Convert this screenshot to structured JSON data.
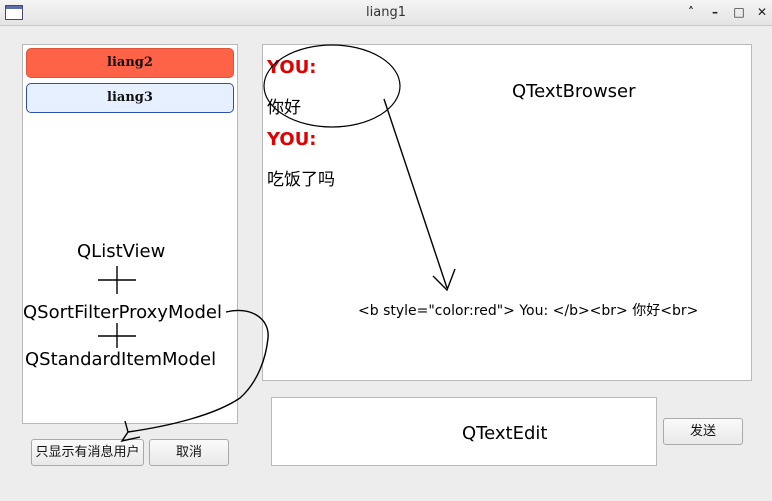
{
  "window": {
    "title": "liang1"
  },
  "user_list": {
    "items": [
      {
        "label": "liang2"
      },
      {
        "label": "liang3"
      }
    ]
  },
  "annotations": {
    "list_view": "QListView",
    "proxy_model": "QSortFilterProxyModel",
    "item_model": "QStandardItemModel",
    "browser": "QTextBrowser",
    "html_sample": "<b style=\"color:red\"> You: </b><br> 你好<br>",
    "edit": "QTextEdit"
  },
  "chat": {
    "messages": [
      {
        "sender": "YOU:",
        "text": "你好"
      },
      {
        "sender": "YOU:",
        "text": "吃饭了吗"
      }
    ]
  },
  "buttons": {
    "show_with_messages": "只显示有消息用户",
    "cancel": "取消",
    "send": "发送"
  },
  "colors": {
    "sender": "#e00000",
    "selected_item": "#ff6347",
    "item_bg": "#e6f0ff"
  }
}
